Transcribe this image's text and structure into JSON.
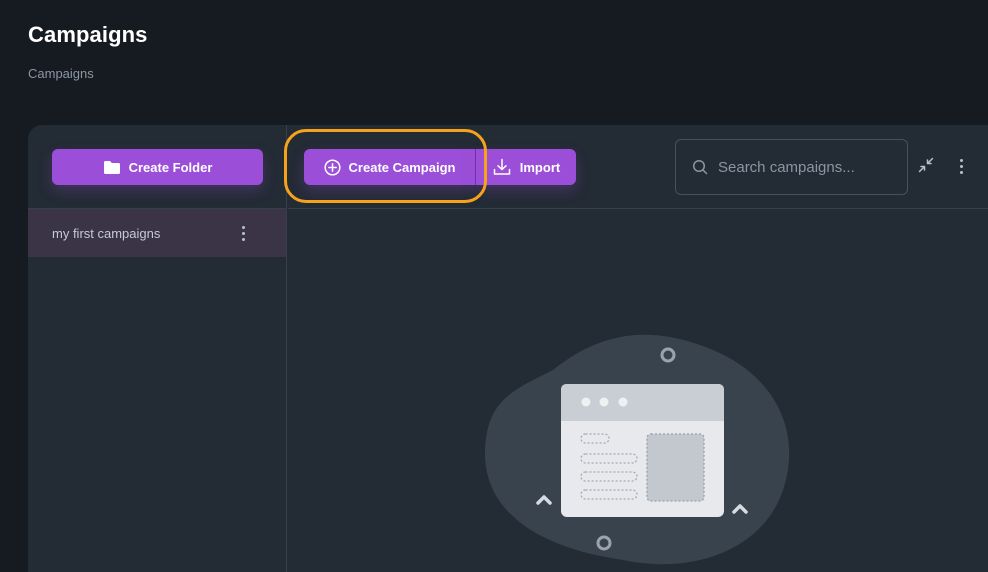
{
  "header": {
    "title": "Campaigns",
    "breadcrumb": "Campaigns"
  },
  "sidebar": {
    "create_folder_label": "Create Folder",
    "folders": [
      {
        "label": "my first campaigns"
      }
    ]
  },
  "toolbar": {
    "create_campaign_label": "Create Campaign",
    "import_label": "Import",
    "search_placeholder": "Search campaigns..."
  },
  "icons": {
    "folder": "folder-icon",
    "plus_circle": "plus-circle-icon",
    "import": "download-icon",
    "search": "search-icon",
    "collapse": "collapse-icon",
    "more": "more-vertical-icon"
  },
  "colors": {
    "accent": "#9b4fd8",
    "highlight": "#f6a31b",
    "background": "#161b22",
    "panel": "#232b35",
    "selected_folder": "#3b3446"
  }
}
